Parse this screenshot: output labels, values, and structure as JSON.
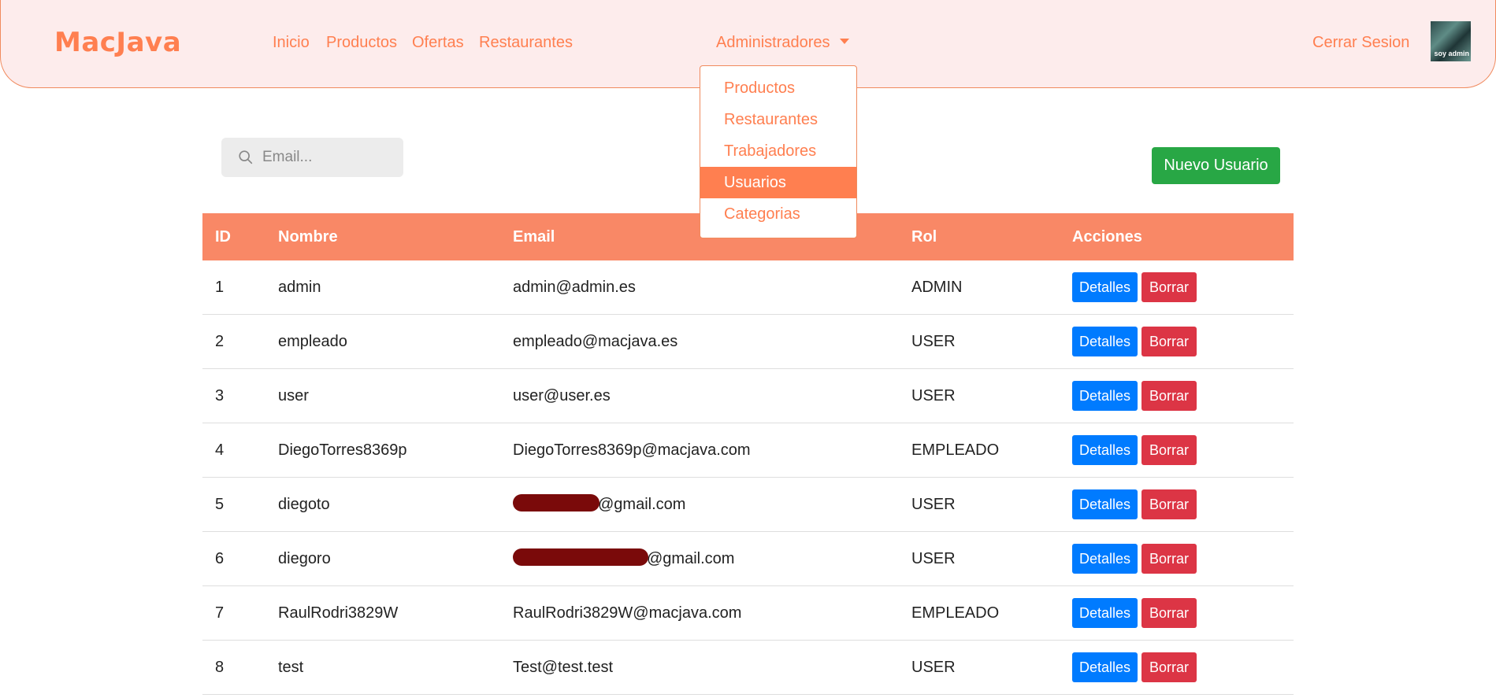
{
  "nav": {
    "brand": "MacJava",
    "links": [
      "Inicio",
      "Productos",
      "Ofertas",
      "Restaurantes"
    ],
    "admin_menu": "Administradores",
    "logout": "Cerrar Sesion",
    "avatar_text": "soy admin"
  },
  "dropdown": {
    "items": [
      "Productos",
      "Restaurantes",
      "Trabajadores",
      "Usuarios",
      "Categorias"
    ],
    "active": "Usuarios"
  },
  "search": {
    "placeholder": "Email...",
    "icon": "search-icon"
  },
  "new_user_label": "Nuevo Usuario",
  "table": {
    "headers": [
      "ID",
      "Nombre",
      "Email",
      "Rol",
      "Acciones"
    ],
    "rows": [
      {
        "id": "1",
        "name": "admin",
        "email": "admin@admin.es",
        "role": "ADMIN"
      },
      {
        "id": "2",
        "name": "empleado",
        "email": "empleado@macjava.es",
        "role": "USER"
      },
      {
        "id": "3",
        "name": "user",
        "email": "user@user.es",
        "role": "USER"
      },
      {
        "id": "4",
        "name": "DiegoTorres8369p",
        "email": "DiegoTorres8369p@macjava.com",
        "role": "EMPLEADO"
      },
      {
        "id": "5",
        "name": "diegoto",
        "email": "@gmail.com",
        "role": "USER"
      },
      {
        "id": "6",
        "name": "diegoro",
        "email": "@gmail.com",
        "role": "USER"
      },
      {
        "id": "7",
        "name": "RaulRodri3829W",
        "email": "RaulRodri3829W@macjava.com",
        "role": "EMPLEADO"
      },
      {
        "id": "8",
        "name": "test",
        "email": "Test@test.test",
        "role": "USER"
      }
    ],
    "details_label": "Detalles",
    "delete_label": "Borrar"
  },
  "colors": {
    "accent": "#ff7f50",
    "header_bg": "#f98866",
    "navbar_bg": "#fdecec",
    "success": "#28a745",
    "primary": "#007bff",
    "danger": "#dc3545"
  }
}
